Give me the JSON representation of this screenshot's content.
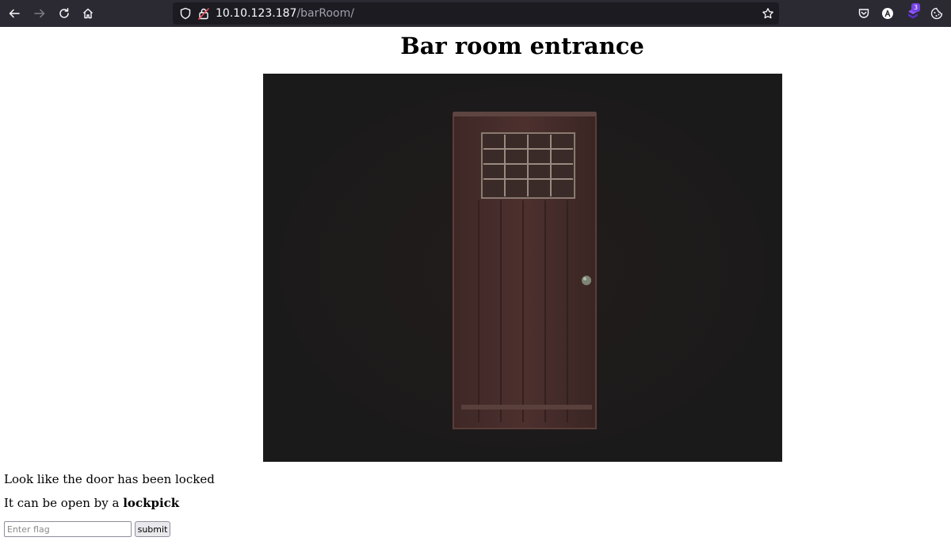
{
  "browser": {
    "url_host": "10.10.123.187",
    "url_path": "/barRoom/",
    "extension_badge": "3",
    "icons": {
      "back": "back-arrow-icon",
      "forward": "forward-arrow-icon",
      "reload": "reload-icon",
      "home": "home-icon",
      "site_info": "shield-icon",
      "connection": "insecure-lock-icon",
      "bookmark": "star-icon",
      "pocket": "pocket-icon",
      "account": "account-icon",
      "extensions": "extension-icon",
      "cookie": "cookie-icon"
    },
    "colors": {
      "toolbar_bg": "#2b2a33",
      "urlbar_bg": "#1c1b22",
      "badge_bg": "#7542e5"
    }
  },
  "page": {
    "title": "Bar room entrance",
    "locked_text": "Look like the door has been locked",
    "lockpick_text_prefix": "It can be open by a ",
    "lockpick_text_bold": "lockpick",
    "flag_input": {
      "placeholder": "Enter flag",
      "value": ""
    },
    "submit_label": "submit"
  }
}
